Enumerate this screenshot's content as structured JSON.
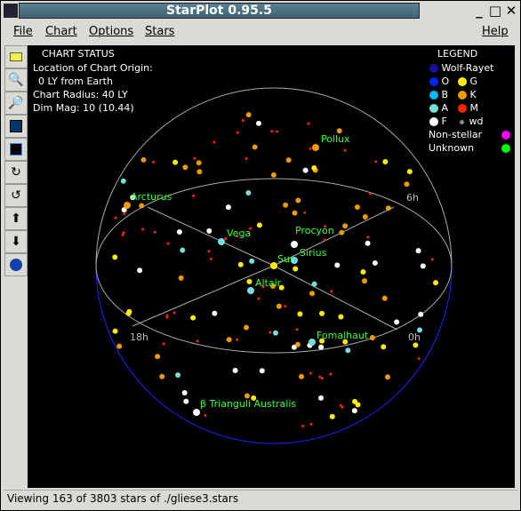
{
  "window": {
    "title": "StarPlot 0.95.5",
    "minimize": "_",
    "maximize": "□",
    "close": "✕"
  },
  "menu": [
    "File",
    "Chart",
    "Options",
    "Stars",
    "Help"
  ],
  "toolbar": [
    "open-folder-icon",
    "zoom-in-icon",
    "zoom-out-icon",
    "chart-view-icon",
    "star-field-icon",
    "rotate-cw-icon",
    "rotate-ccw-icon",
    "arrow-up-icon",
    "arrow-down-icon",
    "globe-icon"
  ],
  "chart_status": {
    "heading": "CHART STATUS",
    "origin_label": "Location of Chart Origin:",
    "origin_value": "0 LY from Earth",
    "radius": "Chart Radius: 40 LY",
    "dim_mag": "Dim Mag: 10 (10.44)"
  },
  "legend": {
    "heading": "LEGEND",
    "items": [
      {
        "label": "Wolf-Rayet",
        "color": "#1a0e99"
      },
      {
        "label": "O",
        "color": "#0022ff"
      },
      {
        "label": "G",
        "color": "#ffee00"
      },
      {
        "label": "B",
        "color": "#00bbff"
      },
      {
        "label": "K",
        "color": "#ee9900"
      },
      {
        "label": "A",
        "color": "#77dddd"
      },
      {
        "label": "M",
        "color": "#ff2200"
      },
      {
        "label": "F",
        "color": "#ffffff"
      },
      {
        "label": "wd",
        "color": "#888888"
      },
      {
        "label": "Non-stellar",
        "color": "#ff00ff"
      },
      {
        "label": "Unknown",
        "color": "#00ff00"
      }
    ]
  },
  "axis_labels": {
    "h6": "6h",
    "h18": "18h",
    "h0": "0h"
  },
  "named_stars": [
    {
      "name": "Pollux",
      "class": "K"
    },
    {
      "name": "Arcturus",
      "class": "K"
    },
    {
      "name": "Vega",
      "class": "A"
    },
    {
      "name": "Procyon",
      "class": "F"
    },
    {
      "name": "Sun",
      "class": "G"
    },
    {
      "name": "Sirius",
      "class": "A"
    },
    {
      "name": "Altair",
      "class": "A"
    },
    {
      "name": "Fomalhaut",
      "class": "A"
    },
    {
      "name": "β Trianguli Australis",
      "class": "F"
    }
  ],
  "status": "Viewing 163 of 3803 stars of ./gliese3.stars"
}
